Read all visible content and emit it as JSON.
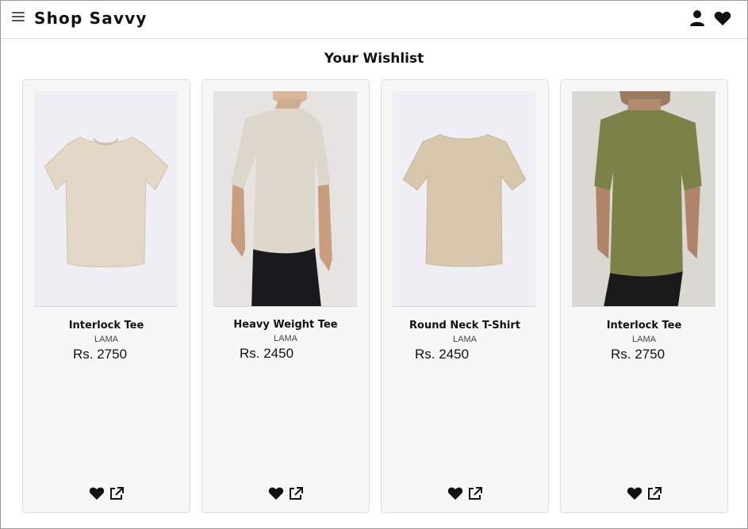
{
  "header": {
    "brand": "Shop Savvy",
    "menu_icon": "hamburger-menu-icon",
    "user_icon": "user-icon",
    "wishlist_icon": "heart-icon"
  },
  "page": {
    "title": "Your Wishlist"
  },
  "products": [
    {
      "name": "Interlock Tee",
      "brand": "LAMA",
      "price": "Rs. 2750",
      "image": "beige t-shirt (flat lay)"
    },
    {
      "name": "Heavy Weight Tee",
      "brand": "LAMA",
      "price": "Rs. 2450",
      "image": "model wearing cream t-shirt"
    },
    {
      "name": "Round Neck T-Shirt",
      "brand": "LAMA",
      "price": "Rs. 2450",
      "image": "tan t-shirt (flat lay)"
    },
    {
      "name": "Interlock Tee",
      "brand": "LAMA",
      "price": "Rs. 2750",
      "image": "model wearing olive t-shirt"
    }
  ],
  "card_actions": {
    "remove_icon": "heart-icon",
    "open_icon": "external-link-icon"
  },
  "colors": {
    "card_bg": "#f7f7f7",
    "flat_tee_1": "#e3d8c6",
    "cream_tee": "#ddd6cc",
    "tan_tee": "#d7c7ad",
    "olive_tee": "#7b8147"
  }
}
